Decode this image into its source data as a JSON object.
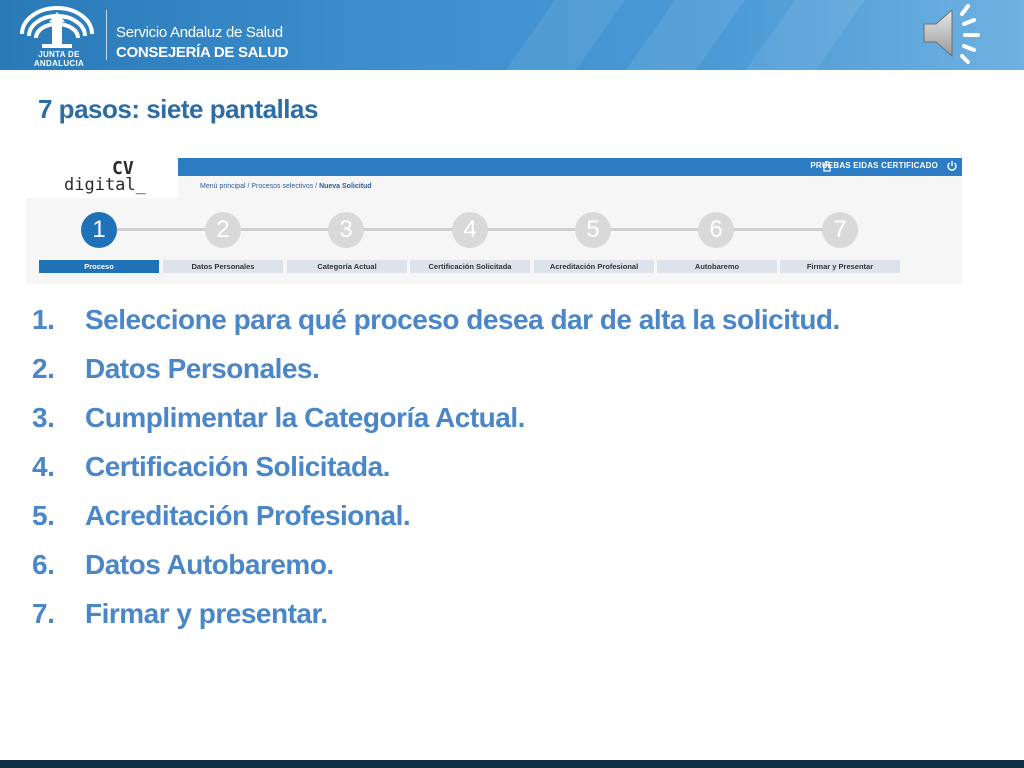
{
  "header": {
    "org_region": "JUNTA DE ANDALUCIA",
    "org_service": "Servicio Andaluz de Salud",
    "org_ministry": "CONSEJERÍA DE SALUD",
    "icons": [
      "junta-emblem-logo",
      "speaker-icon"
    ]
  },
  "slide": {
    "title": "7 pasos: siete pantallas"
  },
  "app": {
    "logo_top": "CV",
    "logo_bottom": "digital_",
    "user_label": "PRUEBAS EIDAS CERTIFICADO",
    "breadcrumb_prefix": "Menú principal / Procesos selectivos / ",
    "breadcrumb_current": "Nueva Solicitud",
    "steps": [
      {
        "number": "1",
        "tab": "Proceso",
        "active": true
      },
      {
        "number": "2",
        "tab": "Datos Personales",
        "active": false
      },
      {
        "number": "3",
        "tab": "Categoría Actual",
        "active": false
      },
      {
        "number": "4",
        "tab": "Certificación Solicitada",
        "active": false
      },
      {
        "number": "5",
        "tab": "Acreditación Profesional",
        "active": false
      },
      {
        "number": "6",
        "tab": "Autobaremo",
        "active": false
      },
      {
        "number": "7",
        "tab": "Firmar y Presentar",
        "active": false
      }
    ],
    "accent_color": "#1f72b8"
  },
  "list": [
    {
      "num": "1.",
      "text": "Seleccione para qué proceso desea dar de alta la solicitud."
    },
    {
      "num": "2.",
      "text": "Datos Personales."
    },
    {
      "num": "3.",
      "text": "Cumplimentar la Categoría Actual."
    },
    {
      "num": "4.",
      "text": "Certificación Solicitada."
    },
    {
      "num": "5.",
      "text": "Acreditación Profesional."
    },
    {
      "num": "6.",
      "text": "Datos Autobaremo."
    },
    {
      "num": "7.",
      "text": "Firmar y presentar."
    }
  ],
  "colors": {
    "banner": "#3e8fcf",
    "title": "#2e6da4",
    "list_text": "#4a86c8",
    "bottom_bar": "#0f3044"
  }
}
